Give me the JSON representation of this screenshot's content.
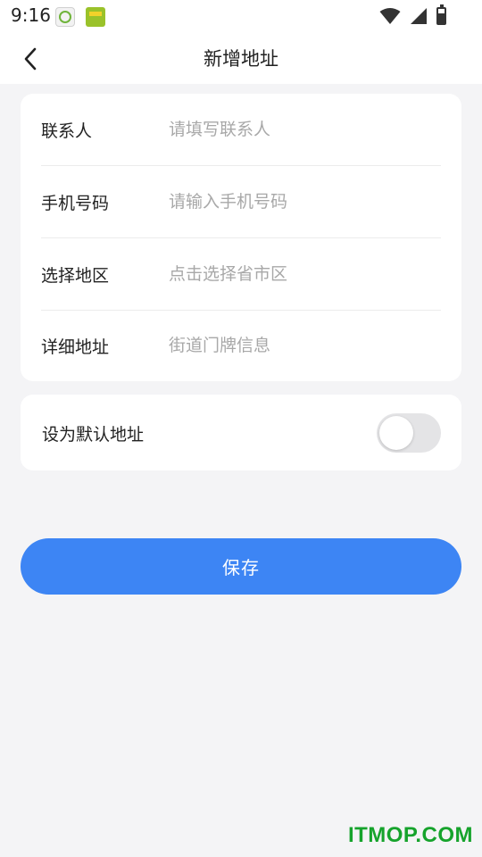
{
  "status_bar": {
    "time": "9:16",
    "icons": [
      "yk-app-icon",
      "green-app-icon",
      "wifi-icon",
      "cell-signal-icon",
      "battery-icon"
    ]
  },
  "header": {
    "title": "新增地址",
    "back_icon": "chevron-left-icon"
  },
  "form": {
    "fields": [
      {
        "label": "联系人",
        "placeholder": "请填写联系人",
        "value": ""
      },
      {
        "label": "手机号码",
        "placeholder": "请输入手机号码",
        "value": ""
      },
      {
        "label": "选择地区",
        "placeholder": "点击选择省市区",
        "value": ""
      },
      {
        "label": "详细地址",
        "placeholder": "街道门牌信息",
        "value": ""
      }
    ]
  },
  "default_address": {
    "label": "设为默认地址",
    "enabled": false
  },
  "save_button": {
    "label": "保存"
  },
  "watermark": {
    "text": "ITMOP.COM"
  },
  "colors": {
    "primary": "#3d85f4",
    "background": "#f4f4f6",
    "placeholder": "#a8a8a8",
    "watermark": "#16a32c"
  }
}
